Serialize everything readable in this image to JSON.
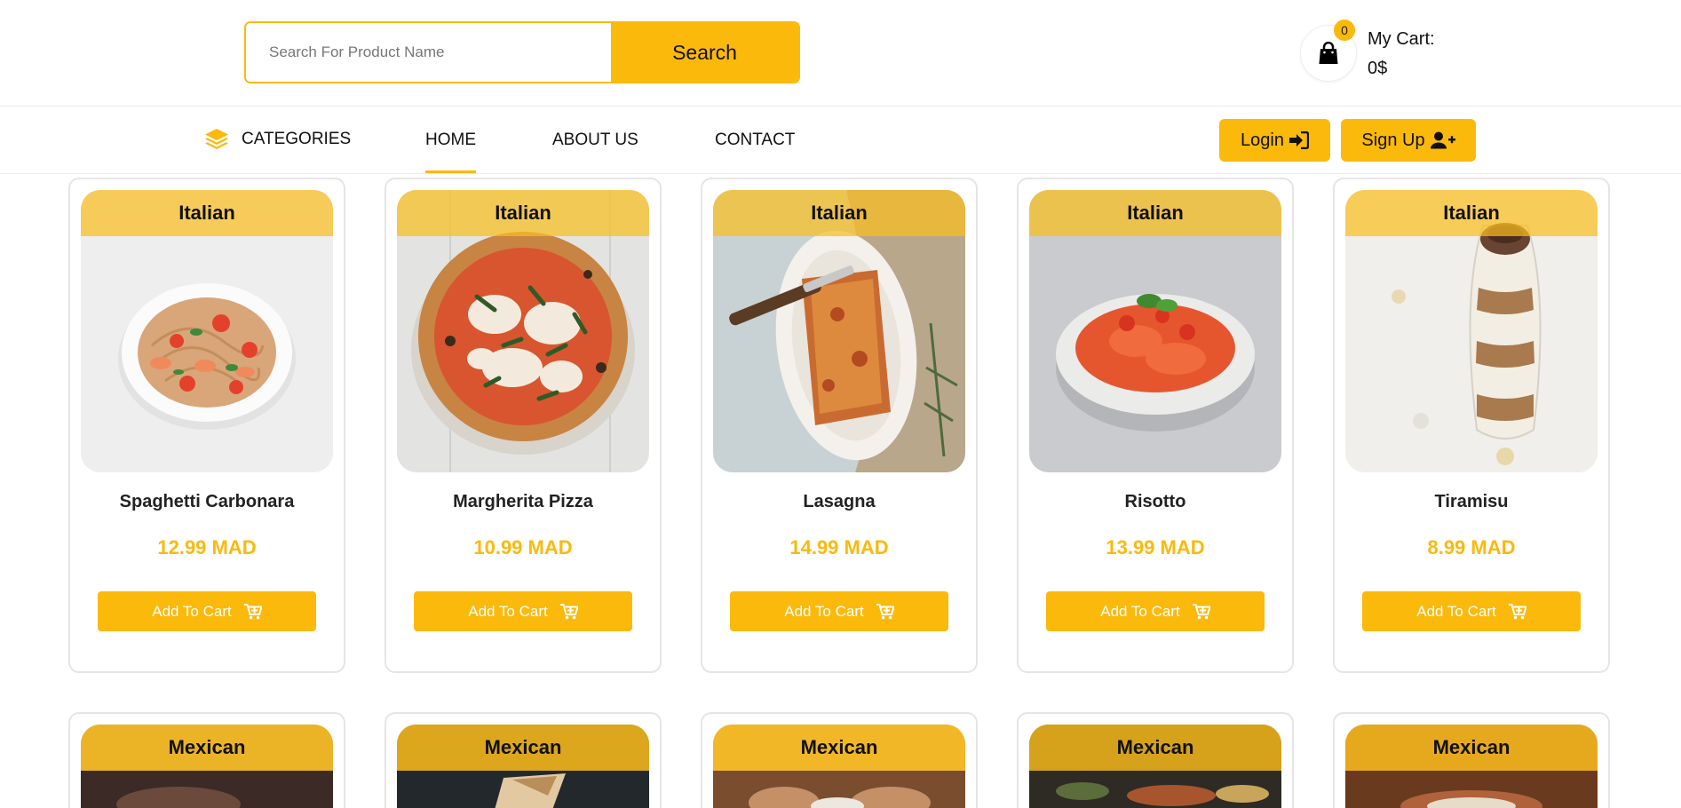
{
  "search": {
    "placeholder": "Search For Product Name",
    "button_label": "Search"
  },
  "cart": {
    "count": "0",
    "label": "My Cart:",
    "total": "0$"
  },
  "nav": {
    "categories_label": "CATEGORIES",
    "links": [
      "HOME",
      "ABOUT US",
      "CONTACT"
    ],
    "active": "HOME",
    "login_label": "Login",
    "signup_label": "Sign Up"
  },
  "colors": {
    "accent": "#fbb90b",
    "price": "#fbb90b",
    "card_border": "#e5e5e5"
  },
  "products": [
    {
      "category": "Italian",
      "name": "Spaghetti Carbonara",
      "price": "12.99 MAD",
      "button": "Add To Cart",
      "image": "spaghetti-plate"
    },
    {
      "category": "Italian",
      "name": "Margherita Pizza",
      "price": "10.99 MAD",
      "button": "Add To Cart",
      "image": "pizza"
    },
    {
      "category": "Italian",
      "name": "Lasagna",
      "price": "14.99 MAD",
      "button": "Add To Cart",
      "image": "lasagna-plate"
    },
    {
      "category": "Italian",
      "name": "Risotto",
      "price": "13.99 MAD",
      "button": "Add To Cart",
      "image": "risotto-bowl"
    },
    {
      "category": "Italian",
      "name": "Tiramisu",
      "price": "8.99 MAD",
      "button": "Add To Cart",
      "image": "tiramisu-glass"
    },
    {
      "category": "Mexican",
      "image": "mexican-dish"
    },
    {
      "category": "Mexican",
      "image": "burrito"
    },
    {
      "category": "Mexican",
      "image": "mexican-dish"
    },
    {
      "category": "Mexican",
      "image": "mexican-dish"
    },
    {
      "category": "Mexican",
      "image": "mexican-dish"
    }
  ]
}
